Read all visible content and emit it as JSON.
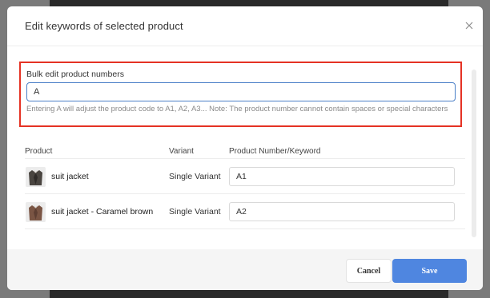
{
  "modal": {
    "title": "Edit keywords of selected product",
    "close_icon": "close-icon"
  },
  "bulk_edit": {
    "label": "Bulk edit product numbers",
    "value": "A",
    "help_text": "Entering A will adjust the product code to A1, A2, A3... Note: The product number cannot contain spaces or special characters",
    "highlight_color": "#e53224"
  },
  "table": {
    "columns": [
      "Product",
      "Variant",
      "Product Number/Keyword"
    ],
    "rows": [
      {
        "image_icon": "suit-jacket-thumbnail",
        "product": "suit jacket",
        "variant": "Single Variant",
        "keyword": "A1"
      },
      {
        "image_icon": "suit-jacket-thumbnail",
        "product": "suit jacket - Caramel brown",
        "variant": "Single Variant",
        "keyword": "A2"
      }
    ]
  },
  "footer": {
    "cancel_label": "Cancel",
    "save_label": "Save",
    "accent_color": "#4f86e0"
  }
}
